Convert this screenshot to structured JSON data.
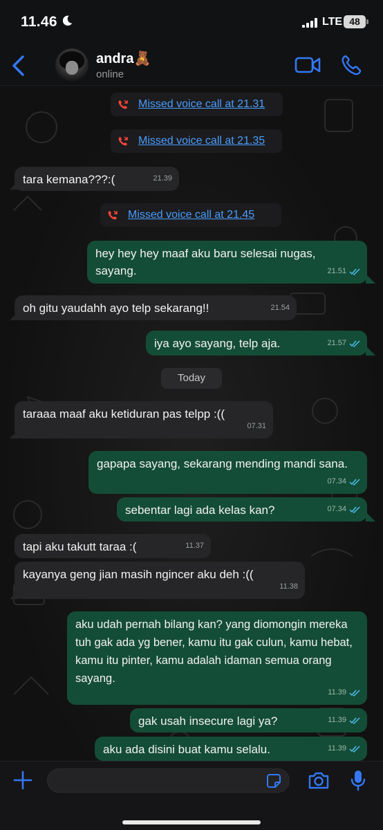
{
  "status_bar": {
    "time": "11.46",
    "network": "LTE",
    "battery": "48"
  },
  "header": {
    "name": "andra🧸",
    "status": "online"
  },
  "colors": {
    "accent": "#3478f6",
    "bubble_out": "#144d37",
    "bubble_in": "#262628",
    "missed_call": "#ff453a",
    "link": "#4a9eff"
  },
  "chat": {
    "system_1": "Missed voice call at 21.31",
    "system_2": "Missed voice call at 21.35",
    "msg_1": {
      "text": "tara kemana???:(",
      "time": "21.39"
    },
    "system_3": "Missed voice call at 21.45",
    "msg_2": {
      "text": "hey hey hey maaf aku baru selesai nugas, sayang.",
      "time": "21.51"
    },
    "msg_3": {
      "text": "oh gitu yaudahh ayo telp sekarang!!",
      "time": "21.54"
    },
    "msg_4": {
      "text": "iya ayo sayang, telp aja.",
      "time": "21.57"
    },
    "date_divider": "Today",
    "msg_5": {
      "text": "taraaa maaf aku ketiduran pas telpp :((",
      "time": "07.31"
    },
    "msg_6": {
      "text": "gapapa sayang, sekarang mending mandi sana.",
      "time": "07.34"
    },
    "msg_7": {
      "text": "sebentar lagi ada kelas kan?",
      "time": "07.34"
    },
    "msg_8": {
      "text": "tapi aku takutt taraa :(",
      "time": "11.37"
    },
    "msg_9": {
      "text": "kayanya geng jian masih ngincer aku deh :((",
      "time": "11.38"
    },
    "msg_10": {
      "text": "aku udah pernah bilang kan? yang diomongin mereka tuh gak ada yg bener, kamu itu gak culun, kamu hebat, kamu itu pinter, kamu adalah idaman semua orang sayang.",
      "time": "11.39"
    },
    "msg_11": {
      "text": "gak usah insecure lagi ya?",
      "time": "11.39"
    },
    "msg_12": {
      "text": "aku ada disini buat kamu selalu.",
      "time": "11.39"
    }
  },
  "icons": {
    "back": "chevron-left-icon",
    "video": "video-call-icon",
    "phone": "phone-icon",
    "missed_call": "missed-call-icon",
    "plus": "plus-icon",
    "sticker": "sticker-icon",
    "camera": "camera-icon",
    "mic": "microphone-icon",
    "read": "double-check-icon"
  }
}
